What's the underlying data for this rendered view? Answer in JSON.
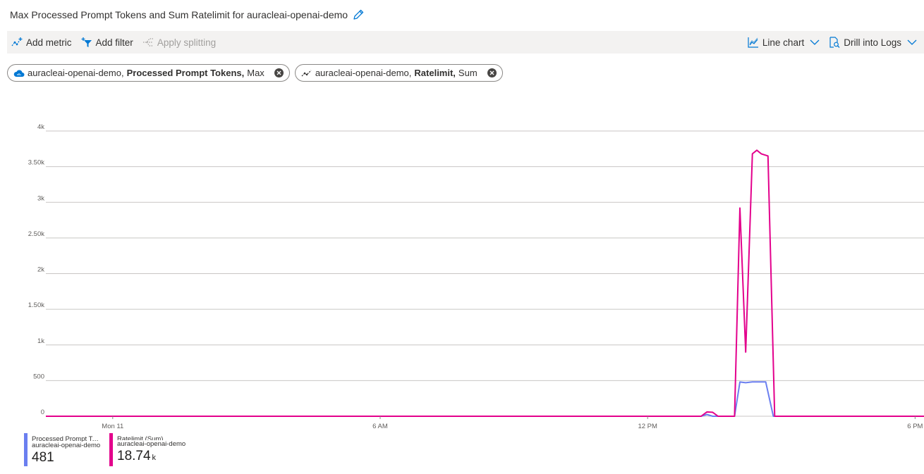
{
  "header": {
    "title": "Max Processed Prompt Tokens and Sum Ratelimit for auracleai-openai-demo"
  },
  "toolbar": {
    "add_metric": "Add metric",
    "add_filter": "Add filter",
    "apply_splitting": "Apply splitting",
    "line_chart": "Line chart",
    "drill_into_logs": "Drill into Logs"
  },
  "pills": [
    {
      "resource": "auracleai-openai-demo,",
      "metric": "Processed Prompt Tokens,",
      "aggregation": "Max"
    },
    {
      "resource": "auracleai-openai-demo,",
      "metric": "Ratelimit,",
      "aggregation": "Sum"
    }
  ],
  "legend": [
    {
      "name": "Processed Prompt Tok...",
      "resource": "auracleai-openai-demo",
      "value": "481",
      "unit": "",
      "color": "#6b7ff0"
    },
    {
      "name": "Ratelimit (Sum)",
      "resource": "auracleai-openai-demo",
      "value": "18.74",
      "unit": "k",
      "color": "#e3008c"
    }
  ],
  "chart_data": {
    "type": "line",
    "x_unit": "hours",
    "xlim": [
      -1.5,
      18.2
    ],
    "ylim": [
      0,
      4000
    ],
    "y_ticks": [
      0,
      500,
      1000,
      1500,
      2000,
      2500,
      3000,
      3500,
      4000
    ],
    "y_tick_labels": [
      "0",
      "500",
      "1k",
      "1.50k",
      "2k",
      "2.50k",
      "3k",
      "3.50k",
      "4k"
    ],
    "x_ticks": [
      0,
      6,
      12,
      18
    ],
    "x_tick_labels": [
      "Mon 11",
      "6 AM",
      "12 PM",
      "6 PM"
    ],
    "grid": true,
    "series": [
      {
        "name": "Processed Prompt Tokens (Max)",
        "color": "#6b7ff0",
        "points": [
          [
            -1.5,
            0
          ],
          [
            13.2,
            0
          ],
          [
            13.33,
            25
          ],
          [
            13.46,
            0
          ],
          [
            13.95,
            0
          ],
          [
            14.07,
            480
          ],
          [
            14.2,
            470
          ],
          [
            14.35,
            481
          ],
          [
            14.5,
            481
          ],
          [
            14.65,
            481
          ],
          [
            14.82,
            0
          ],
          [
            18.2,
            0
          ]
        ]
      },
      {
        "name": "Ratelimit (Sum)",
        "color": "#e3008c",
        "points": [
          [
            -1.5,
            0
          ],
          [
            13.2,
            0
          ],
          [
            13.33,
            60
          ],
          [
            13.46,
            55
          ],
          [
            13.58,
            0
          ],
          [
            13.95,
            0
          ],
          [
            14.07,
            2920
          ],
          [
            14.2,
            900
          ],
          [
            14.35,
            3680
          ],
          [
            14.45,
            3730
          ],
          [
            14.55,
            3680
          ],
          [
            14.7,
            3650
          ],
          [
            14.85,
            0
          ],
          [
            18.2,
            0
          ]
        ]
      }
    ]
  }
}
